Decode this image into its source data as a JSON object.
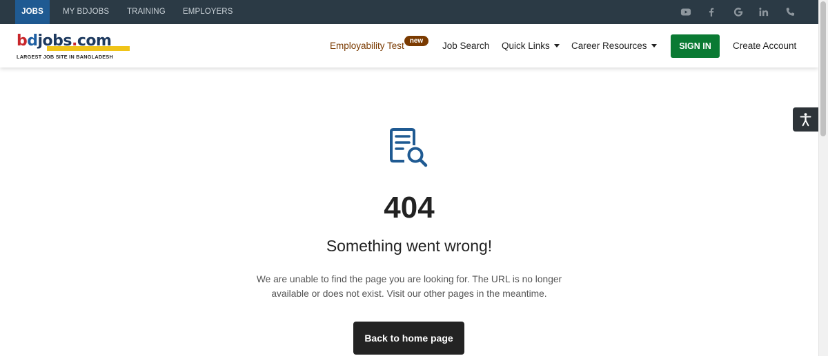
{
  "topbar": {
    "tabs": [
      {
        "label": "JOBS",
        "active": true
      },
      {
        "label": "MY BDJOBS",
        "active": false
      },
      {
        "label": "TRAINING",
        "active": false
      },
      {
        "label": "EMPLOYERS",
        "active": false
      }
    ],
    "social_icons": [
      "youtube-icon",
      "facebook-icon",
      "google-icon",
      "linkedin-icon",
      "phone-icon"
    ],
    "background": "#2b3a45",
    "active_color": "#1f5a92"
  },
  "logo": {
    "b": "b",
    "d": "d",
    "rest": "jobs",
    "dot": ".",
    "com": "com",
    "tagline": "LARGEST JOB SITE IN BANGLADESH"
  },
  "nav": {
    "employability_test": "Employability Test",
    "new_badge": "new",
    "job_search": "Job Search",
    "quick_links": "Quick Links",
    "career_resources": "Career Resources",
    "sign_in": "SIGN IN",
    "create_account": "Create Account"
  },
  "colors": {
    "sign_in_bg": "#0a7a33",
    "employability": "#7a3a00",
    "icon_blue": "#1f5a92"
  },
  "error": {
    "icon": "document-search-icon",
    "code": "404",
    "headline": "Something went wrong!",
    "description_line1": "We are unable to find the page you are looking for. The URL is no longer",
    "description_line2": "available or does not exist. Visit our other pages in the meantime.",
    "button": "Back to home page"
  },
  "accessibility": {
    "icon": "accessibility-icon"
  }
}
